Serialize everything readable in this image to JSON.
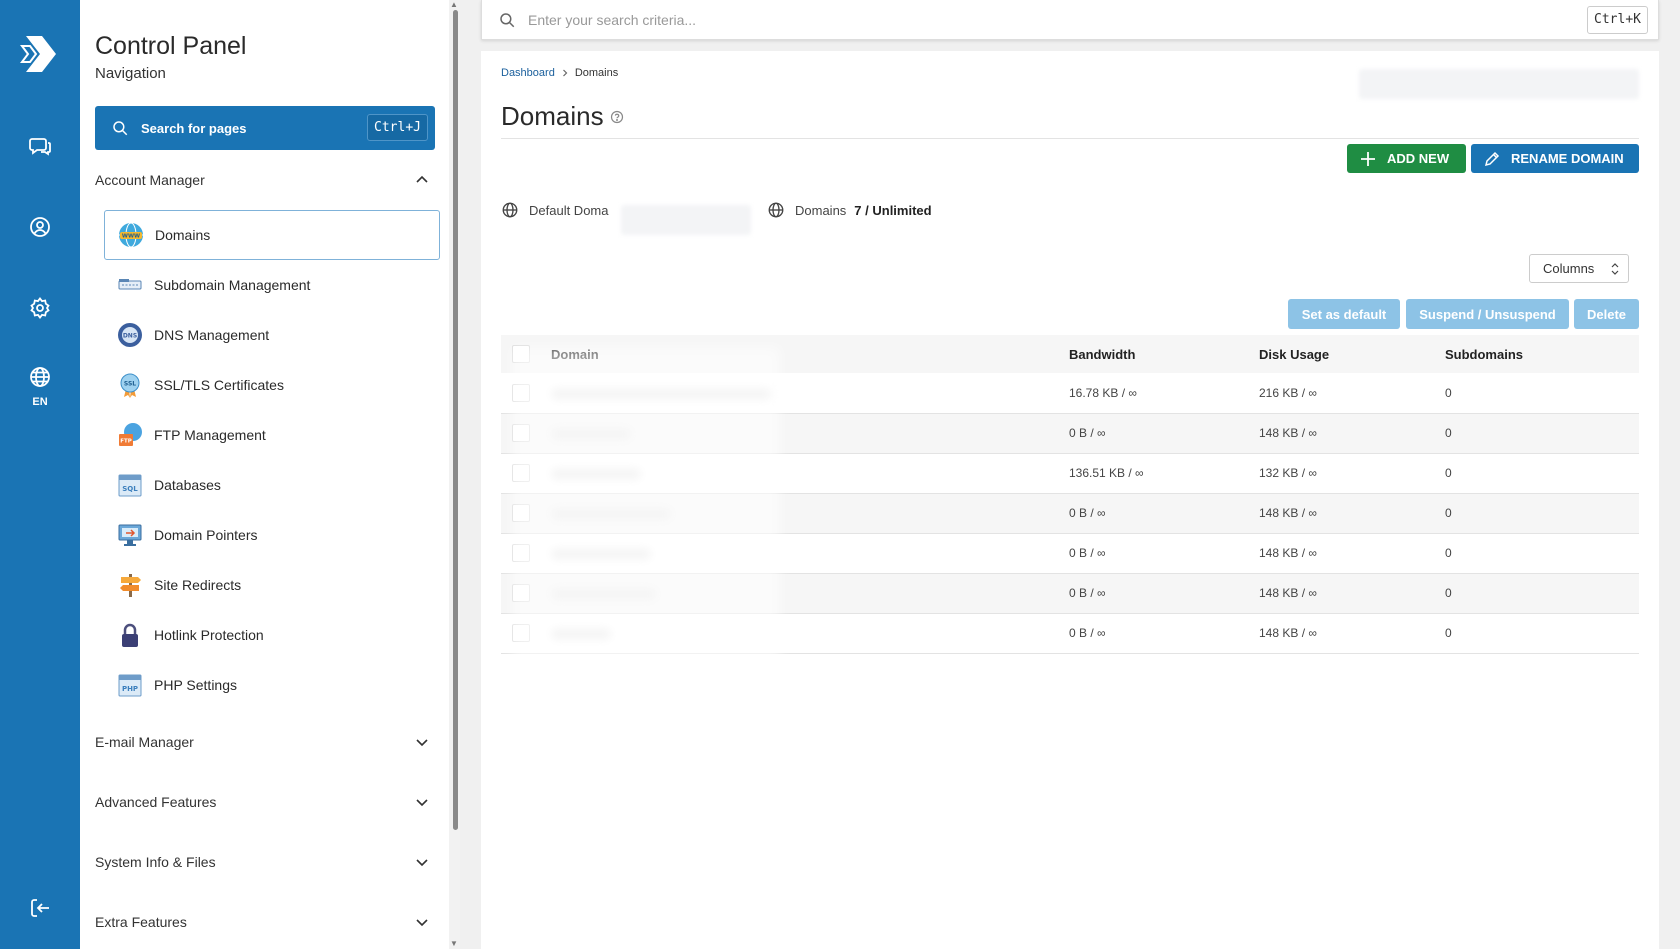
{
  "rail": {
    "lang": "EN",
    "icons": [
      "logo-icon",
      "chat-icon",
      "user-icon",
      "gear-icon",
      "globe-icon",
      "logout-icon"
    ]
  },
  "nav": {
    "title": "Control Panel",
    "subtitle": "Navigation",
    "search_label": "Search for pages",
    "search_shortcut": "Ctrl+J",
    "sections": [
      {
        "label": "Account Manager",
        "expanded": true
      },
      {
        "label": "E-mail Manager",
        "expanded": false
      },
      {
        "label": "Advanced Features",
        "expanded": false
      },
      {
        "label": "System Info & Files",
        "expanded": false
      },
      {
        "label": "Extra Features",
        "expanded": false
      }
    ],
    "items": [
      {
        "label": "Domains",
        "icon": "www-globe-icon",
        "active": true
      },
      {
        "label": "Subdomain Management",
        "icon": "subdomain-icon"
      },
      {
        "label": "DNS Management",
        "icon": "dns-icon"
      },
      {
        "label": "SSL/TLS Certificates",
        "icon": "ssl-badge-icon"
      },
      {
        "label": "FTP Management",
        "icon": "ftp-icon"
      },
      {
        "label": "Databases",
        "icon": "sql-icon"
      },
      {
        "label": "Domain Pointers",
        "icon": "monitor-icon"
      },
      {
        "label": "Site Redirects",
        "icon": "signpost-icon"
      },
      {
        "label": "Hotlink Protection",
        "icon": "lock-icon"
      },
      {
        "label": "PHP Settings",
        "icon": "php-icon"
      }
    ]
  },
  "topsearch": {
    "placeholder": "Enter your search criteria...",
    "shortcut": "Ctrl+K"
  },
  "breadcrumb": {
    "home": "Dashboard",
    "current": "Domains"
  },
  "page": {
    "title": "Domains",
    "add_new": "ADD NEW",
    "rename_domain": "RENAME DOMAIN",
    "default_domain_label": "Default Doma",
    "domains_label": "Domains",
    "domains_count": "7 / Unlimited",
    "columns_label": "Columns",
    "set_default": "Set as default",
    "suspend": "Suspend / Unsuspend",
    "delete": "Delete"
  },
  "table": {
    "headers": [
      "Domain",
      "Bandwidth",
      "Disk Usage",
      "Subdomains"
    ],
    "rows": [
      {
        "bandwidth": "16.78 KB / ∞",
        "disk": "216 KB / ∞",
        "subdomains": "0"
      },
      {
        "bandwidth": "0 B / ∞",
        "disk": "148 KB / ∞",
        "subdomains": "0"
      },
      {
        "bandwidth": "136.51 KB / ∞",
        "disk": "132 KB / ∞",
        "subdomains": "0"
      },
      {
        "bandwidth": "0 B / ∞",
        "disk": "148 KB / ∞",
        "subdomains": "0"
      },
      {
        "bandwidth": "0 B / ∞",
        "disk": "148 KB / ∞",
        "subdomains": "0"
      },
      {
        "bandwidth": "0 B / ∞",
        "disk": "148 KB / ∞",
        "subdomains": "0"
      },
      {
        "bandwidth": "0 B / ∞",
        "disk": "148 KB / ∞",
        "subdomains": "0"
      }
    ]
  },
  "colors": {
    "brand": "#1a74b4",
    "add_green": "#1f8d43",
    "disabled_blue": "#8dc3e6"
  }
}
